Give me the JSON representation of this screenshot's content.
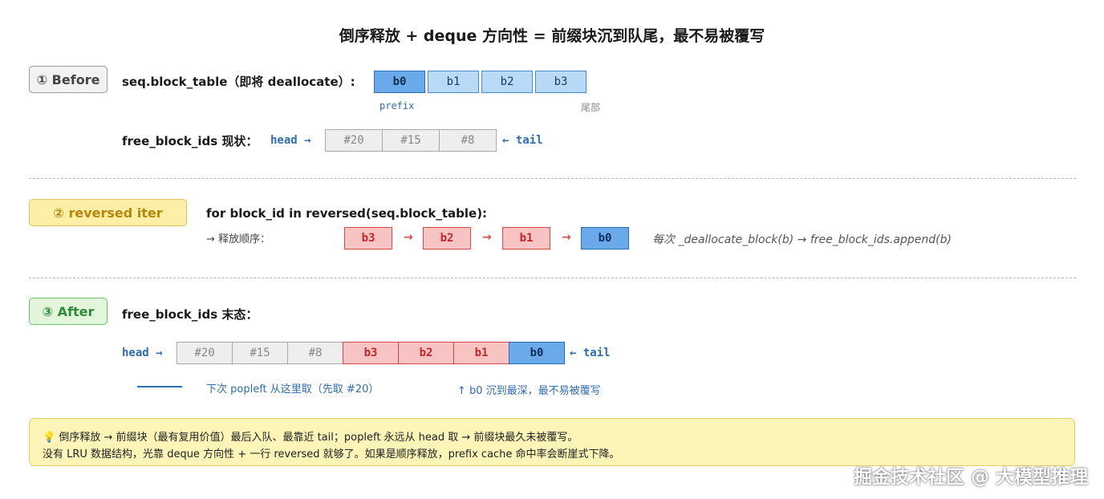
{
  "title": "倒序释放 + deque 方向性 = 前缀块沉到队尾，最不易被覆写",
  "before": {
    "step_label": "① Before",
    "block_table_label": "seq.block_table（即将 deallocate）:",
    "blocks": [
      "b0",
      "b1",
      "b2",
      "b3"
    ],
    "prefix_label": "prefix",
    "tail_label": "尾部",
    "free_label": "free_block_ids 现状：",
    "head_label": "head →",
    "free_ids": [
      "#20",
      "#15",
      "#8"
    ],
    "tail_arrow_label": "← tail"
  },
  "reversed": {
    "step_label": "② reversed iter",
    "loop_label": "for block_id in reversed(seq.block_table):",
    "order_label": "→ 释放顺序：",
    "order": [
      "b3",
      "b2",
      "b1",
      "b0"
    ],
    "arrow": "→",
    "note": "每次 _deallocate_block(b) → free_block_ids.append(b)"
  },
  "after": {
    "step_label": "③ After",
    "final_label": "free_block_ids 末态：",
    "head_label": "head →",
    "cells": [
      "#20",
      "#15",
      "#8",
      "b3",
      "b2",
      "b1",
      "b0"
    ],
    "tail_arrow_label": "← tail",
    "next_popleft": "下次 popleft 从这里取（先取 #20）",
    "b0_note": "↑ b0 沉到最深，最不易被覆写"
  },
  "note": {
    "icon": "💡",
    "line1": "倒序释放 → 前缀块（最有复用价值）最后入队、最靠近 tail；popleft 永远从 head 取 → 前缀块最久未被覆写。",
    "line2": "没有 LRU 数据结构，光靠 deque 方向性 + 一行 reversed 就够了。如果是顺序释放，prefix cache 命中率会断崖式下降。"
  },
  "watermark": "掘金技术社区 @ 大模型推理",
  "colors": {
    "blue_dark": "#6aa9ea",
    "blue_light": "#b9daf7",
    "red": "#f7c3c3",
    "gray": "#eeeeee",
    "note_bg": "#fdf5b8"
  }
}
